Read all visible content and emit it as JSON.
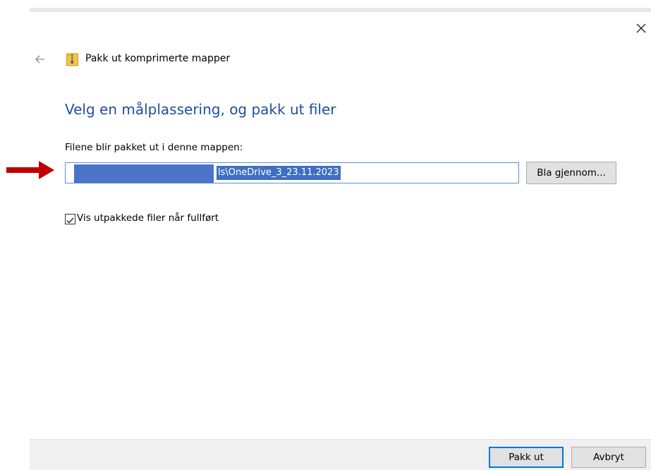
{
  "window": {
    "title": "Pakk ut komprimerte mapper",
    "close_icon": "close-icon",
    "back_icon": "arrow-left-icon",
    "app_icon": "zip-folder-icon"
  },
  "main": {
    "heading": "Velg en målplassering, og pakk ut filer",
    "destination_label": "Filene blir pakket ut i denne mappen:",
    "destination_value_visible": "ls\\OneDrive_3_23.11.2023",
    "browse_label": "Bla gjennom...",
    "show_files_label": "Vis utpakkede filer når fullført",
    "show_files_checked": true
  },
  "footer": {
    "extract_label": "Pakk ut",
    "cancel_label": "Avbryt"
  },
  "colors": {
    "heading": "#1f4e9e",
    "selection": "#3f6fc5",
    "annotation_arrow": "#c00000",
    "focus_border": "#0078d7"
  }
}
